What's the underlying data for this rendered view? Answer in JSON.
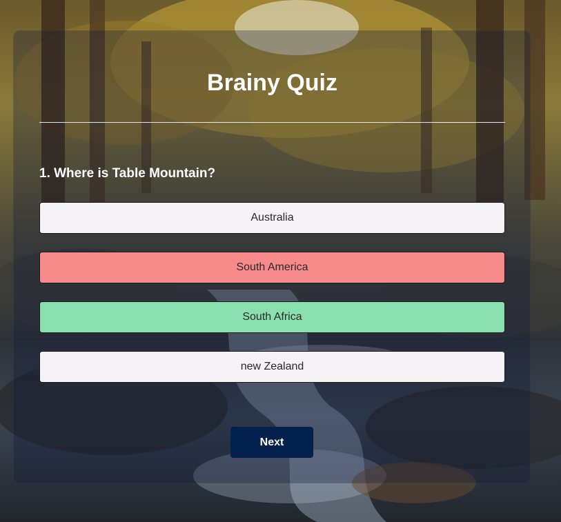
{
  "app": {
    "title": "Brainy Quiz"
  },
  "question": {
    "text": "1. Where is Table Mountain?"
  },
  "answers": [
    {
      "label": "Australia",
      "state": "neutral"
    },
    {
      "label": "South America",
      "state": "wrong"
    },
    {
      "label": "South Africa",
      "state": "correct"
    },
    {
      "label": "new Zealand",
      "state": "neutral"
    }
  ],
  "controls": {
    "next_label": "Next"
  },
  "colors": {
    "neutral": "#f4f2f4",
    "wrong": "#f78a8a",
    "correct": "#8adfae",
    "next_button": "#03204f"
  }
}
